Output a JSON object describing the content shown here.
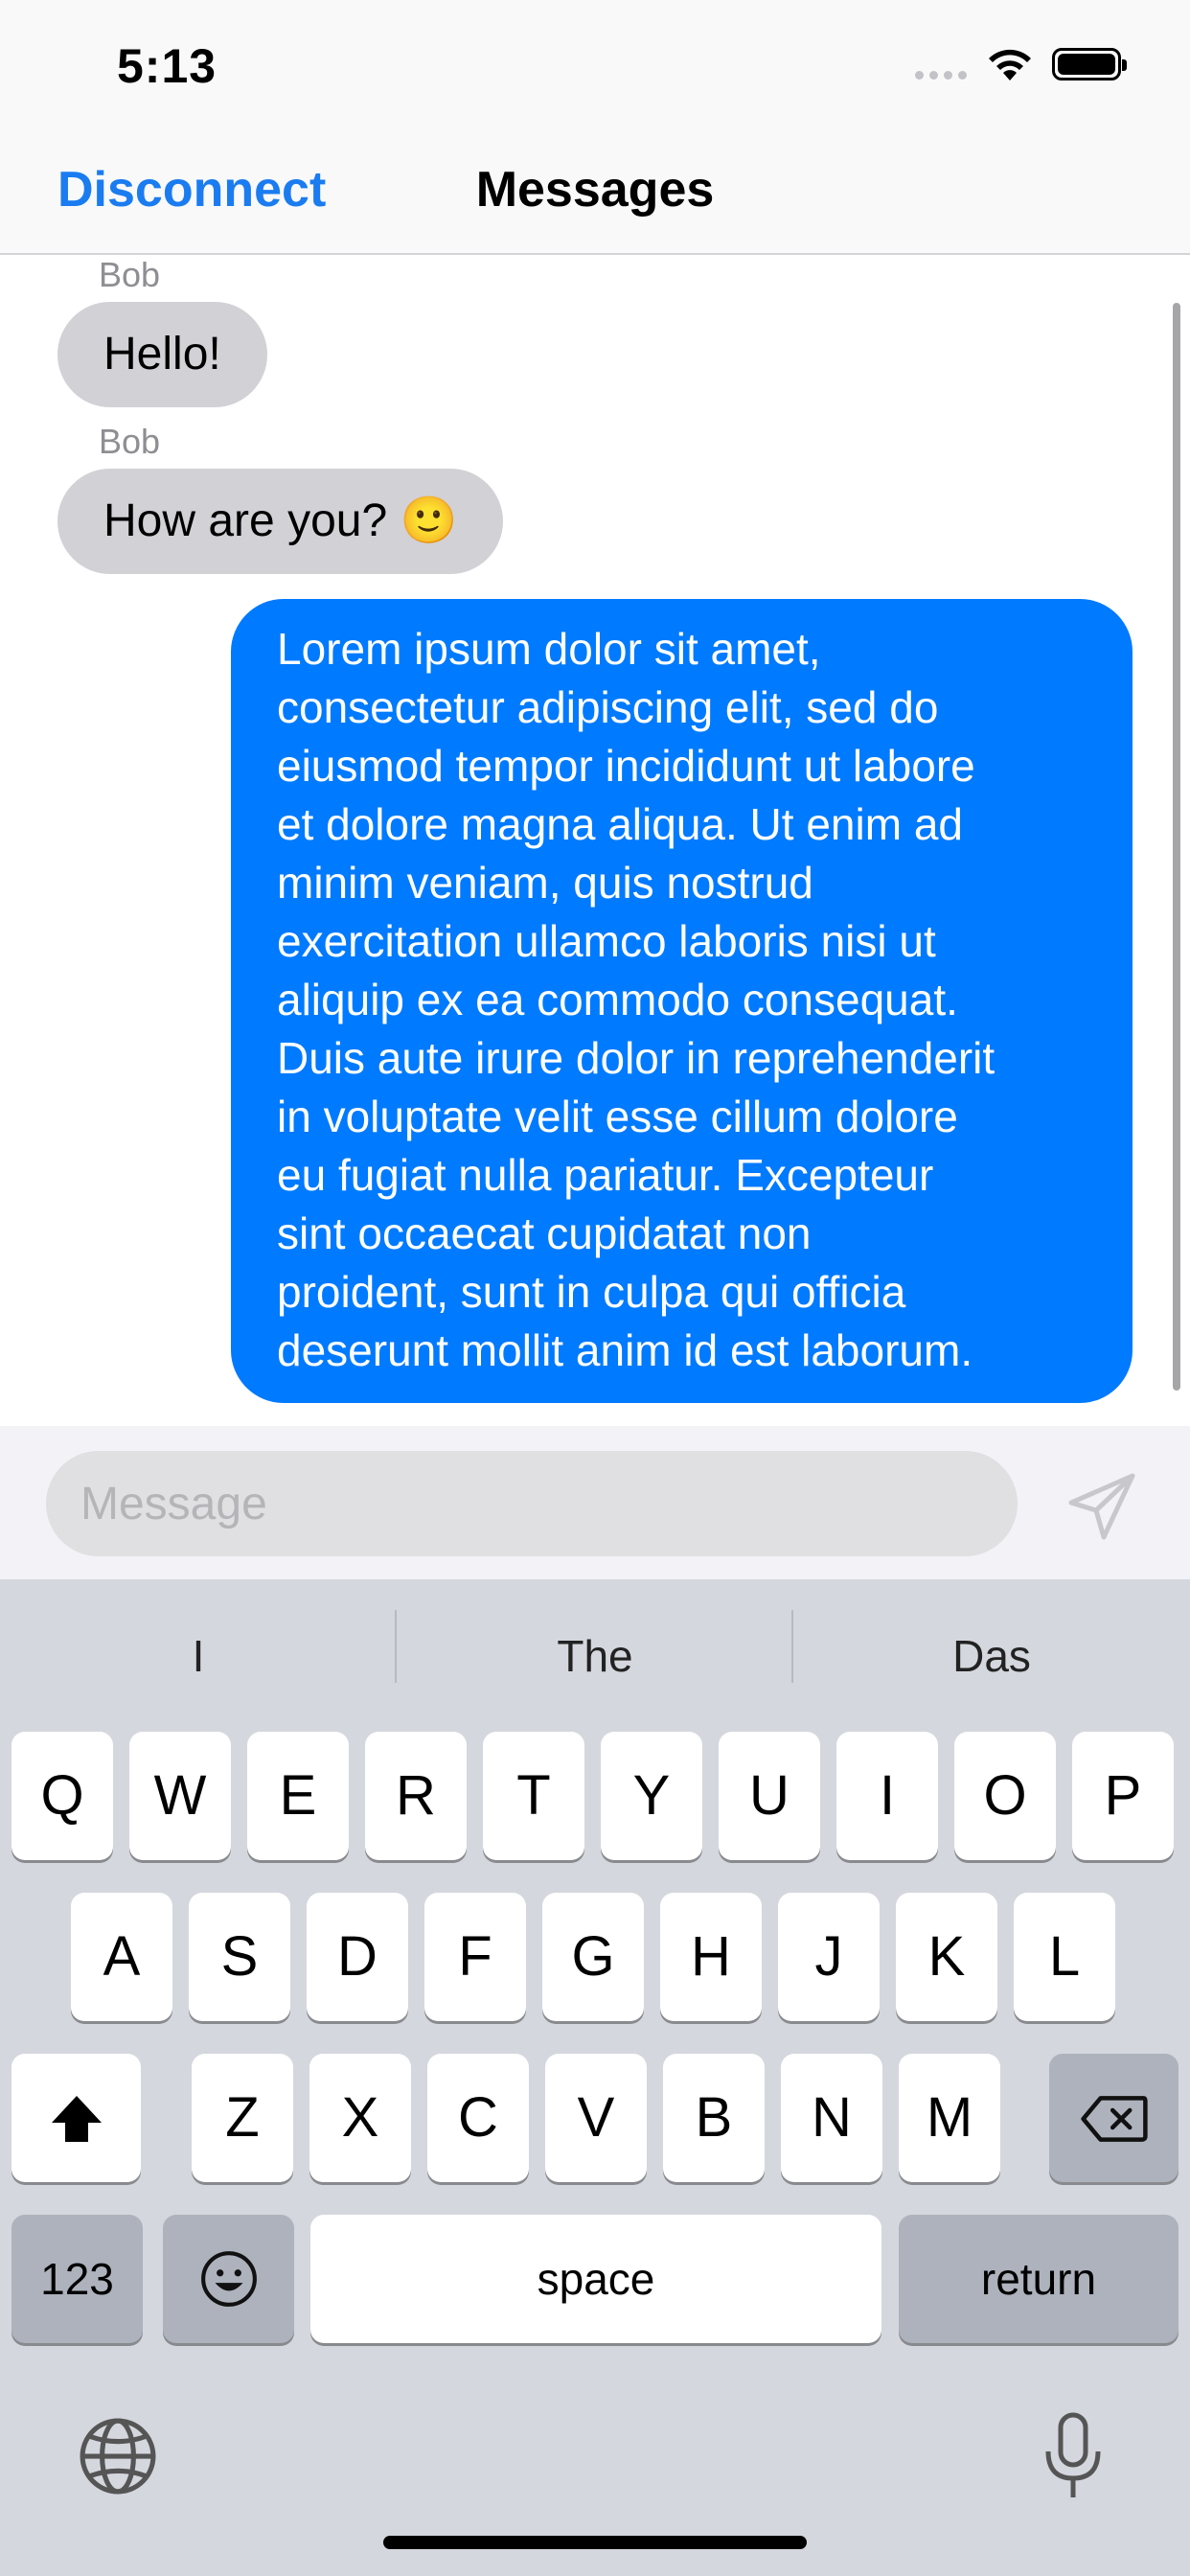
{
  "status_bar": {
    "time": "5:13"
  },
  "nav": {
    "left_button": "Disconnect",
    "title": "Messages"
  },
  "messages": [
    {
      "sender": "Bob",
      "text": "Hello!",
      "direction": "incoming"
    },
    {
      "sender": "Bob",
      "text": "How are you? 🙂",
      "direction": "incoming"
    },
    {
      "direction": "outgoing",
      "lines": [
        "Lorem ipsum dolor sit amet,",
        "consectetur adipiscing elit, sed do",
        "eiusmod tempor incididunt ut labore",
        "et dolore magna aliqua. Ut enim ad",
        "minim veniam, quis nostrud",
        "exercitation ullamco laboris nisi ut",
        "aliquip ex ea commodo consequat.",
        "Duis aute irure dolor in reprehenderit",
        "in voluptate velit esse cillum dolore",
        "eu fugiat nulla pariatur. Excepteur",
        "sint occaecat cupidatat non",
        "proident, sunt in culpa qui officia",
        "deserunt mollit anim id est laborum."
      ]
    }
  ],
  "composer": {
    "placeholder": "Message",
    "value": "",
    "send_icon": "paper-plane-icon"
  },
  "keyboard": {
    "suggestions": [
      "I",
      "The",
      "Das"
    ],
    "row1": [
      "Q",
      "W",
      "E",
      "R",
      "T",
      "Y",
      "U",
      "I",
      "O",
      "P"
    ],
    "row2": [
      "A",
      "S",
      "D",
      "F",
      "G",
      "H",
      "J",
      "K",
      "L"
    ],
    "row3": [
      "Z",
      "X",
      "C",
      "V",
      "B",
      "N",
      "M"
    ],
    "numbers_key": "123",
    "space_key": "space",
    "return_key": "return",
    "shift_icon": "shift-icon",
    "backspace_icon": "backspace-icon",
    "emoji_icon": "emoji-icon",
    "globe_icon": "globe-icon",
    "mic_icon": "microphone-icon"
  },
  "colors": {
    "accent": "#007aff",
    "link": "#1a7cf0",
    "incoming_bubble": "#d1d1d6",
    "keyboard_bg": "#d4d7dd"
  }
}
